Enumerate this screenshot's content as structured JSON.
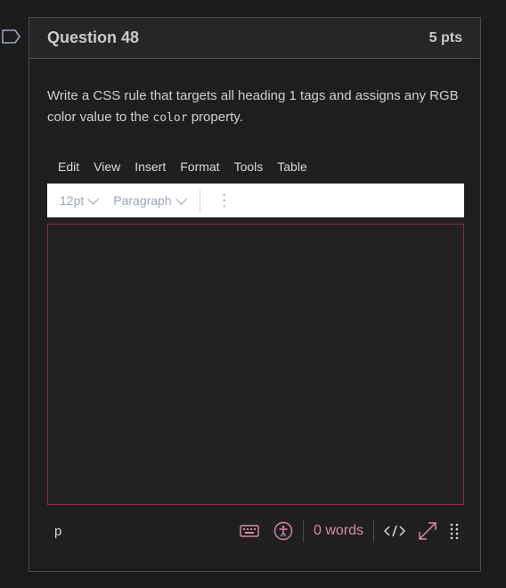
{
  "question": {
    "title": "Question 48",
    "points": "5 pts",
    "text_before": "Write a CSS rule that targets all heading 1 tags and assigns any RGB color value to the ",
    "code_word": "color",
    "text_after": " property."
  },
  "editor": {
    "menu": [
      "Edit",
      "View",
      "Insert",
      "Format",
      "Tools",
      "Table"
    ],
    "font_size": "12pt",
    "block_format": "Paragraph",
    "path": "p",
    "word_count": "0 words"
  },
  "colors": {
    "background": "#1b1b1d",
    "border_focus": "#8b2b44",
    "accent": "#d78aa8"
  },
  "icons": [
    "flag-icon",
    "keyboard-icon",
    "accessibility-icon",
    "html-source-icon",
    "fullscreen-icon",
    "drag-handle-icon"
  ]
}
